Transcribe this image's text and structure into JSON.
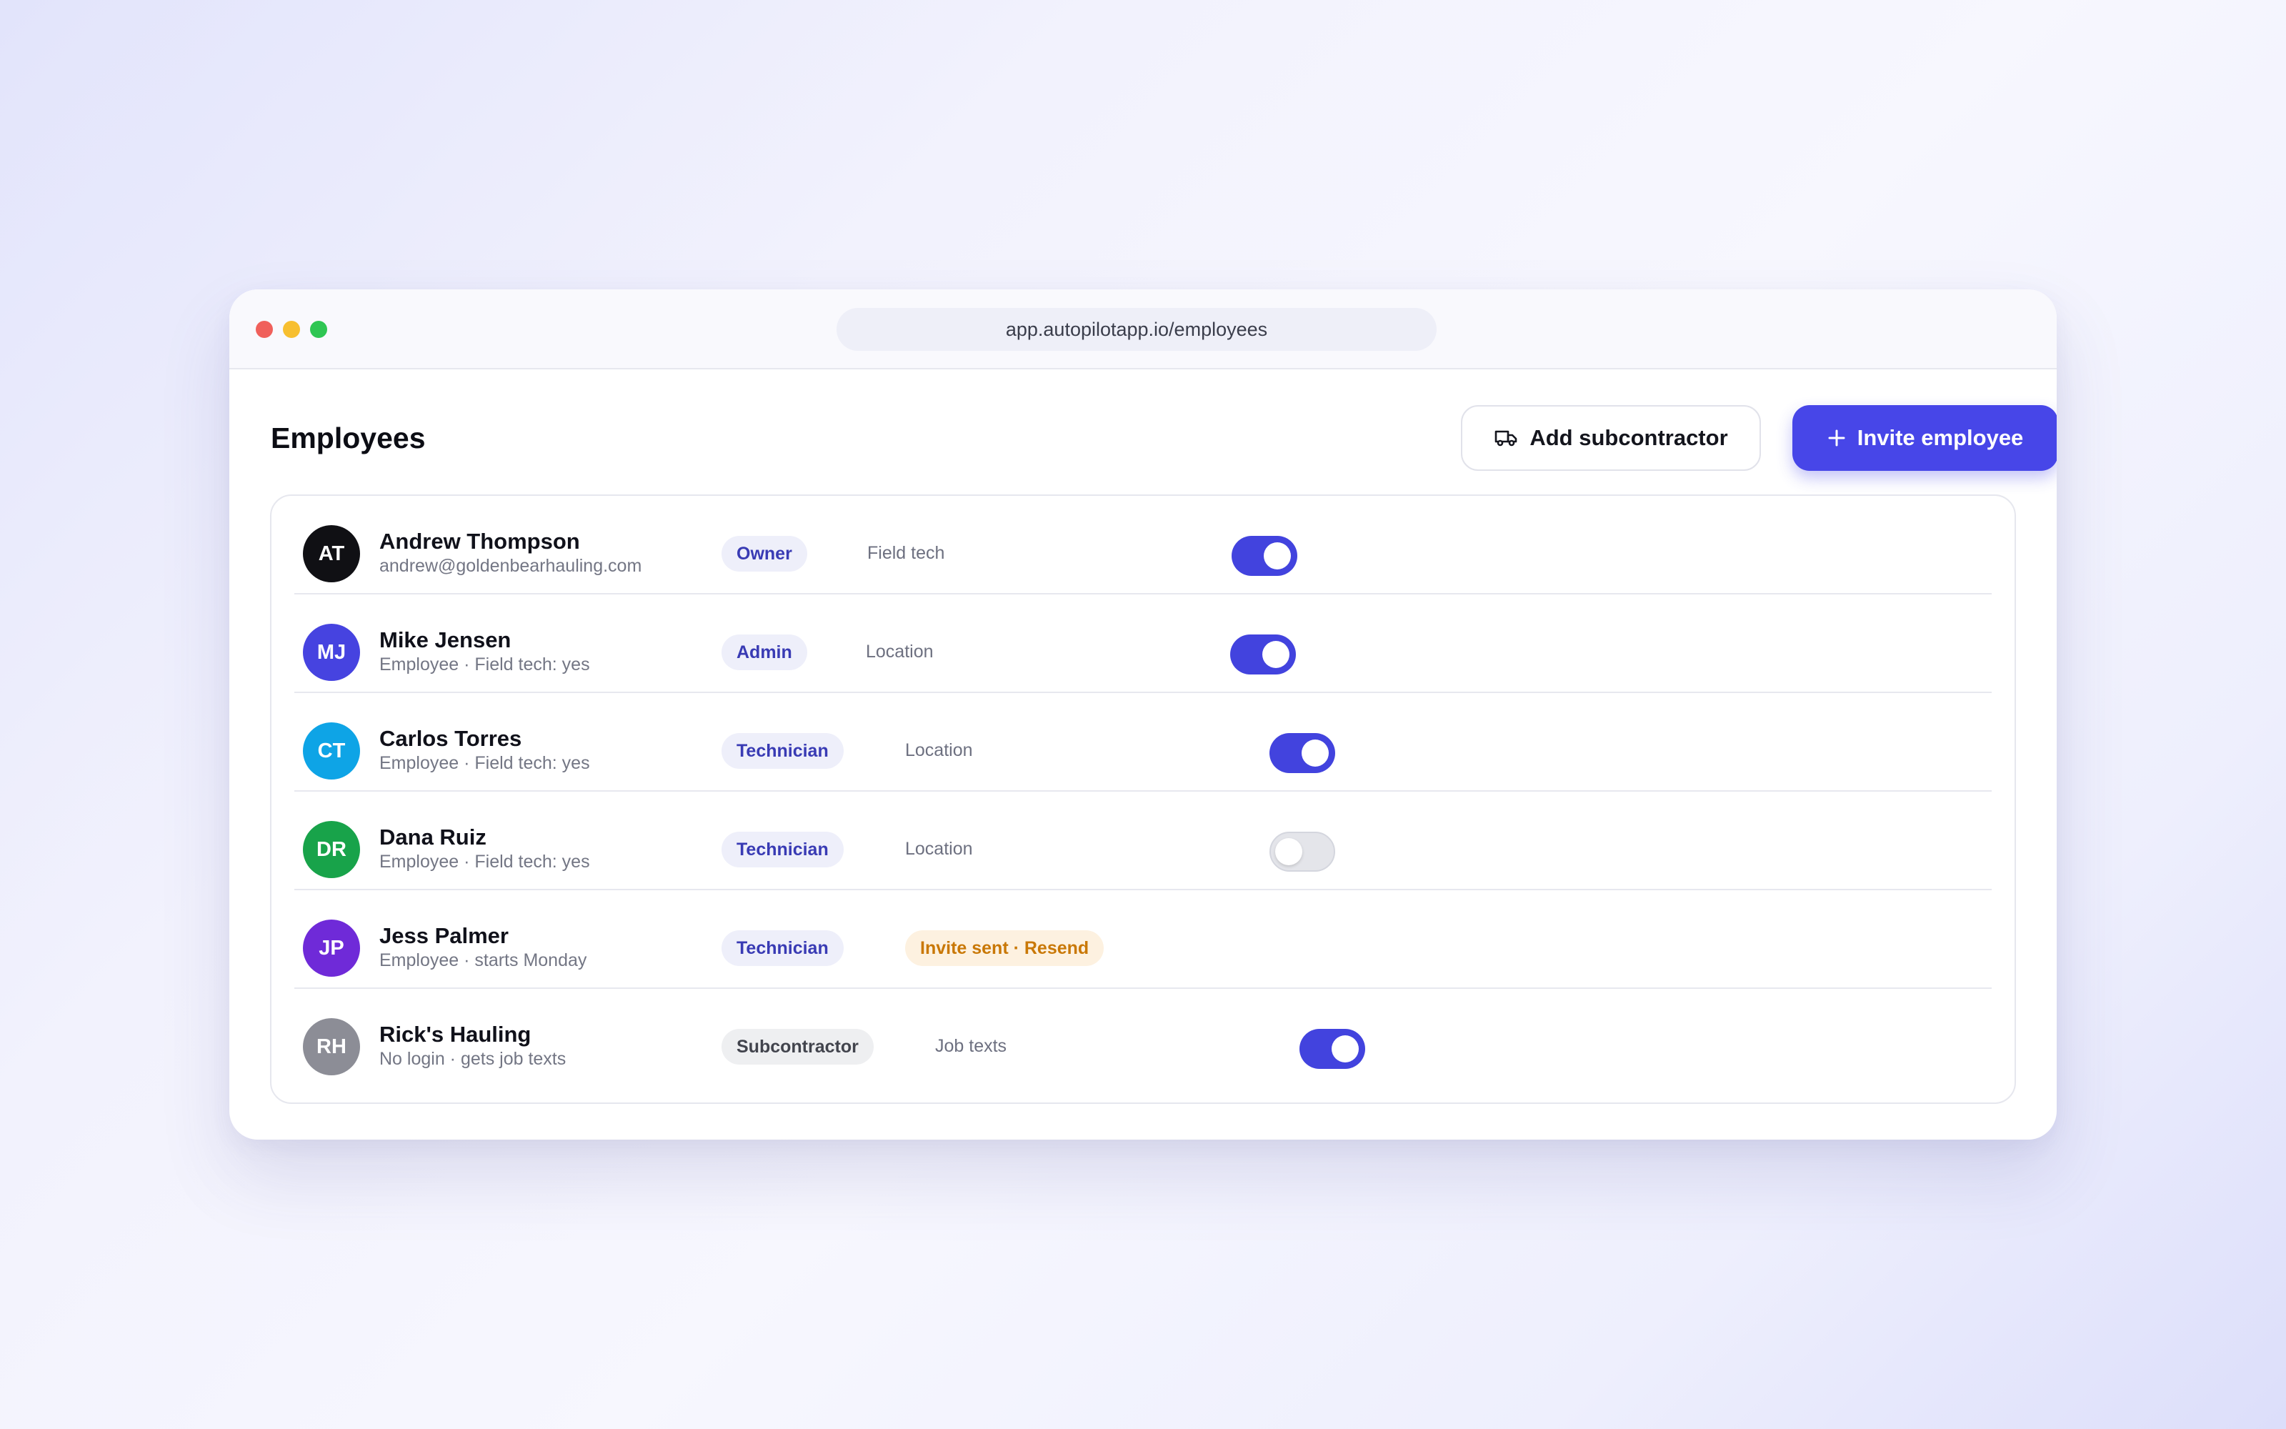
{
  "browser": {
    "url": "app.autopilotapp.io/employees"
  },
  "header": {
    "title": "Employees",
    "add_subcontractor_label": "Add subcontractor",
    "invite_employee_label": "Invite employee"
  },
  "colors": {
    "accent": "#4746e8",
    "toggle_on": "#4243de",
    "toggle_off": "#e4e5ea",
    "role_badge_bg": "#eeeffa",
    "role_badge_text": "#393bb4",
    "warning_text": "#c97806"
  },
  "employees": [
    {
      "initials": "AT",
      "avatar_color": "#101014",
      "name": "Andrew Thompson",
      "subtitle": "andrew@goldenbearhauling.com",
      "role": "Owner",
      "control_label": "Field tech",
      "toggle": true
    },
    {
      "initials": "MJ",
      "avatar_color": "#4643e0",
      "name": "Mike Jensen",
      "subtitle": "Employee · Field tech: yes",
      "role": "Admin",
      "control_label": "Location",
      "toggle": true
    },
    {
      "initials": "CT",
      "avatar_color": "#0ea4e6",
      "name": "Carlos Torres",
      "subtitle": "Employee · Field tech: yes",
      "role": "Technician",
      "control_label": "Location",
      "toggle": true
    },
    {
      "initials": "DR",
      "avatar_color": "#18a34a",
      "name": "Dana Ruiz",
      "subtitle": "Employee · Field tech: yes",
      "role": "Technician",
      "control_label": "Location",
      "toggle": false
    },
    {
      "initials": "JP",
      "avatar_color": "#6f2ad8",
      "name": "Jess Palmer",
      "subtitle": "Employee · starts Monday",
      "role": "Technician",
      "status": "Invite sent · Resend"
    },
    {
      "initials": "RH",
      "avatar_color": "#8c8d96",
      "name": "Rick's Hauling",
      "subtitle": "No login · gets job texts",
      "role": "Subcontractor",
      "control_label": "Job texts",
      "toggle": true
    }
  ]
}
